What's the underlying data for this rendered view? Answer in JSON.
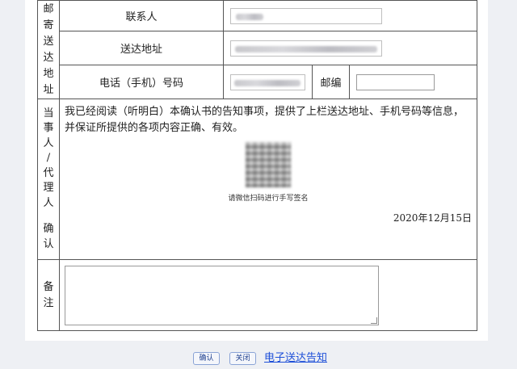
{
  "mailing": {
    "side_label": [
      "邮",
      "寄",
      "送",
      "达",
      "地",
      "址"
    ],
    "contact_label": "联系人",
    "address_label": "送达地址",
    "phone_label": "电话（手机）号码",
    "postcode_label": "邮编",
    "postcode_value": ""
  },
  "confirm": {
    "side_label": [
      "当",
      "事",
      "人",
      "/",
      "代",
      "理",
      "人",
      "",
      "确",
      "认"
    ],
    "statement": "我已经阅读（听明白）本确认书的告知事项，提供了上栏送达地址、手机号码等信息，并保证所提供的各项内容正确、有效。",
    "qr_caption": "请微信扫码进行手写签名",
    "date": "2020年12月15日"
  },
  "remarks": {
    "side_label": [
      "备",
      "注"
    ],
    "value": ""
  },
  "actions": {
    "confirm_label": "确认",
    "close_label": "关闭",
    "notice_link": "电子送达告知"
  }
}
